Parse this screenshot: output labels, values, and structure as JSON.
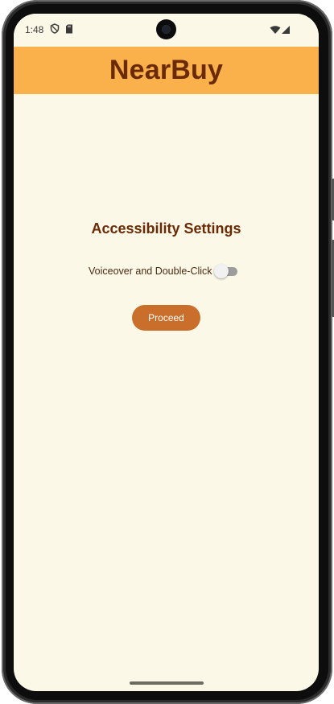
{
  "status_bar": {
    "time": "1:48",
    "icons": [
      "shield-icon",
      "sd-card-icon",
      "wifi-icon",
      "cellular-signal-icon"
    ]
  },
  "app_bar": {
    "title": "NearBuy",
    "background_color": "#fab04b",
    "title_color": "#6a2a06"
  },
  "main": {
    "heading": "Accessibility Settings",
    "settings": [
      {
        "label": "Voiceover and Double-Click",
        "enabled": false
      }
    ],
    "proceed_label": "Proceed",
    "proceed_color": "#c96f2b"
  },
  "colors": {
    "screen_background": "#fbf8e8"
  }
}
